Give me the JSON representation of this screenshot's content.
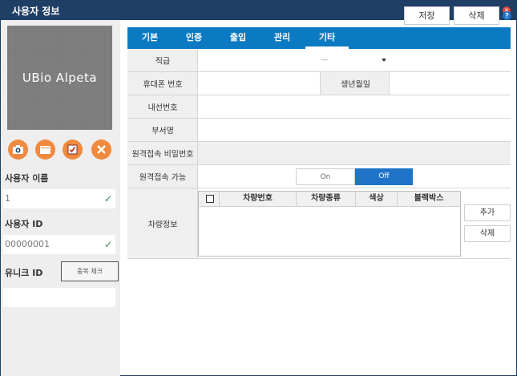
{
  "window": {
    "title": "사용자 정보"
  },
  "photo": {
    "logo_text": "UBio Alpeta"
  },
  "left_actions": [
    "camera-icon",
    "folder-icon",
    "calendar-check-icon",
    "close-icon"
  ],
  "left": {
    "name_label": "사용자 이름",
    "name_value": "1",
    "id_label": "사용자 ID",
    "id_value": "00000001",
    "unique_label": "유니크 ID",
    "dup_check_label": "중복 체크",
    "unique_value": ""
  },
  "toolbar": {
    "save_label": "저장",
    "delete_label": "삭제",
    "help": "?"
  },
  "tabs": [
    {
      "label": "기본"
    },
    {
      "label": "인증"
    },
    {
      "label": "출입"
    },
    {
      "label": "관리"
    },
    {
      "label": "기타"
    }
  ],
  "active_tab": "기타",
  "form": {
    "rank_label": "직급",
    "rank_value": "—",
    "mobile_label": "휴대폰 번호",
    "birth_label": "생년월일",
    "ext_label": "내선번호",
    "dept_label": "부서명",
    "remote_pw_label": "원격접속 비밀번호",
    "remote_enable_label": "원격접속 가능",
    "on_label": "On",
    "off_label": "Off",
    "vehicle_label": "차량정보"
  },
  "vehicle_table": {
    "columns": [
      "차량번호",
      "차량종류",
      "색상",
      "블랙박스"
    ],
    "rows": []
  },
  "vehicle_buttons": {
    "add_label": "추가",
    "delete_label": "삭제"
  },
  "colors": {
    "titlebar": "#1f3f66",
    "tabbar": "#0c7ac3",
    "accent": "#1f74c9",
    "action_orange": "#f08a3f"
  }
}
